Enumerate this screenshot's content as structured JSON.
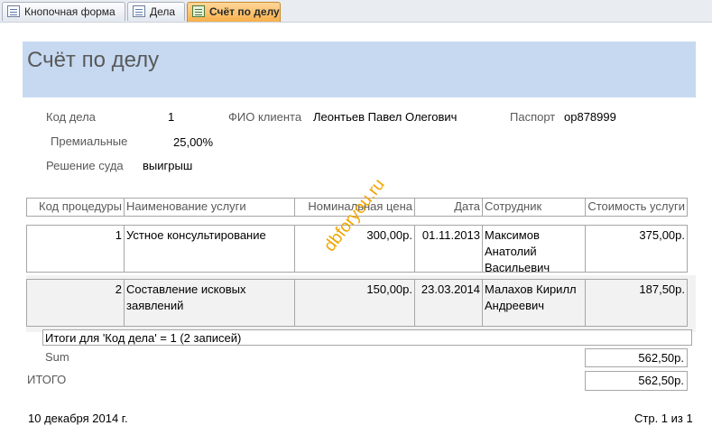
{
  "tabs": [
    {
      "label": "Кнопочная форма"
    },
    {
      "label": "Дела"
    },
    {
      "label": "Счёт по делу"
    }
  ],
  "report": {
    "title": "Счёт по делу",
    "case_id_label": "Код дела",
    "case_id": "1",
    "client_label": "ФИО клиента",
    "client": "Леонтьев Павел Олегович",
    "passport_label": "Паспорт",
    "passport": "ор878999",
    "bonus_label": "Премиальные",
    "bonus": "25,00%",
    "decision_label": "Решение суда",
    "decision": "выигрыш"
  },
  "table": {
    "headers": [
      "Код процедуры",
      "Наименование услуги",
      "Номинальная цена",
      "Дата",
      "Сотрудник",
      "Стоимость услуги"
    ],
    "rows": [
      {
        "id": "1",
        "service": "Устное консультирование",
        "price": "300,00р.",
        "date": "01.11.2013",
        "employee": "Максимов Анатолий Васильевич",
        "cost": "375,00р."
      },
      {
        "id": "2",
        "service": "Составление исковых заявлений",
        "price": "150,00р.",
        "date": "23.03.2014",
        "employee": "Малахов Кирилл Андреевич",
        "cost": "187,50р."
      }
    ]
  },
  "totals": {
    "group_text": "Итоги для 'Код дела' =  1 (2 записей)",
    "sum_label": "Sum",
    "sum_value": "562,50р.",
    "total_label": "ИТОГО",
    "total_value": "562,50р."
  },
  "footer": {
    "date": "10 декабря 2014 г.",
    "page": "Стр. 1 из 1"
  },
  "watermark": "dbforyou.ru"
}
